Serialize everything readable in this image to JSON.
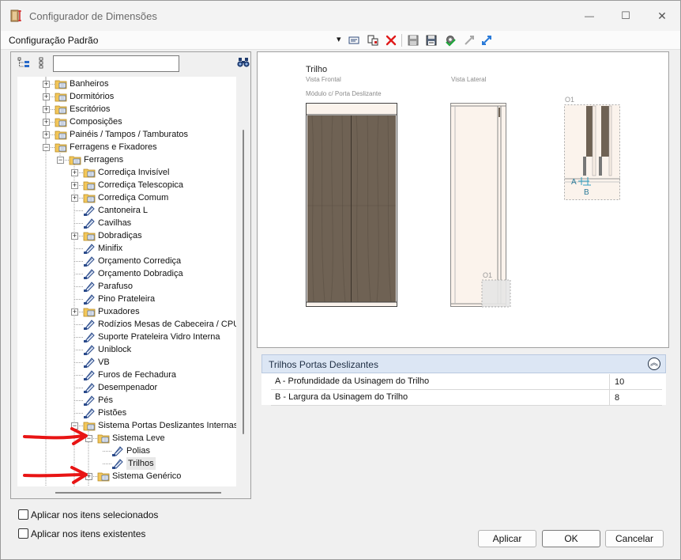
{
  "window": {
    "title": "Configurador de Dimensões",
    "minimize_glyph": "—",
    "maximize_glyph": "☐",
    "close_glyph": "✕"
  },
  "toolbar": {
    "config_name": "Configuração Padrão",
    "dropdown_glyph": "▾",
    "icons": [
      "settings-list-icon",
      "copy-config-icon",
      "delete-icon",
      "save-icon",
      "save-as-icon",
      "apply-gear-icon",
      "expand-diagonal-icon",
      "collapse-diagonal-icon"
    ]
  },
  "tree": {
    "search_value": "",
    "nodes": [
      {
        "label": "Banheiros",
        "expander": "+",
        "icon": "folder"
      },
      {
        "label": "Dormitórios",
        "expander": "+",
        "icon": "folder"
      },
      {
        "label": "Escritórios",
        "expander": "+",
        "icon": "folder"
      },
      {
        "label": "Composições",
        "expander": "+",
        "icon": "folder"
      },
      {
        "label": "Painéis / Tampos / Tamburatos",
        "expander": "+",
        "icon": "folder"
      },
      {
        "label": "Ferragens e Fixadores",
        "expander": "−",
        "icon": "folder"
      },
      {
        "label": "Ferragens",
        "expander": "−",
        "icon": "folder"
      },
      {
        "label": "Corrediça Invisível",
        "expander": "+",
        "icon": "folder"
      },
      {
        "label": "Corrediça Telescopica",
        "expander": "+",
        "icon": "folder"
      },
      {
        "label": "Corrediça Comum",
        "expander": "+",
        "icon": "folder"
      },
      {
        "label": "Cantoneira L",
        "expander": "",
        "icon": "item"
      },
      {
        "label": "Cavilhas",
        "expander": "",
        "icon": "item"
      },
      {
        "label": "Dobradiças",
        "expander": "+",
        "icon": "folder"
      },
      {
        "label": "Minifix",
        "expander": "",
        "icon": "item"
      },
      {
        "label": "Orçamento Corrediça",
        "expander": "",
        "icon": "item"
      },
      {
        "label": "Orçamento Dobradiça",
        "expander": "",
        "icon": "item"
      },
      {
        "label": "Parafuso",
        "expander": "",
        "icon": "item"
      },
      {
        "label": "Pino Prateleira",
        "expander": "",
        "icon": "item"
      },
      {
        "label": "Puxadores",
        "expander": "+",
        "icon": "folder"
      },
      {
        "label": "Rodízios Mesas de Cabeceira / CPU",
        "expander": "",
        "icon": "item"
      },
      {
        "label": "Suporte Prateleira Vidro Interna",
        "expander": "",
        "icon": "item"
      },
      {
        "label": "Uniblock",
        "expander": "",
        "icon": "item"
      },
      {
        "label": "VB",
        "expander": "",
        "icon": "item"
      },
      {
        "label": "Furos de Fechadura",
        "expander": "",
        "icon": "item"
      },
      {
        "label": "Desempenador",
        "expander": "",
        "icon": "item"
      },
      {
        "label": "Pés",
        "expander": "",
        "icon": "item"
      },
      {
        "label": "Pistões",
        "expander": "",
        "icon": "item"
      },
      {
        "label": "Sistema Portas Deslizantes Internas",
        "expander": "−",
        "icon": "folder"
      },
      {
        "label": "Sistema Leve",
        "expander": "−",
        "icon": "folder"
      },
      {
        "label": "Polias",
        "expander": "",
        "icon": "item"
      },
      {
        "label": "Trilhos",
        "expander": "",
        "icon": "item",
        "selected": true
      },
      {
        "label": "Sistema Genérico",
        "expander": "+",
        "icon": "folder"
      }
    ]
  },
  "preview": {
    "title": "Trilho",
    "front_view": "Vista Frontal",
    "side_view": "Vista Lateral",
    "module": "Módulo c/ Porta Deslizante",
    "detail_tag_side": "O1",
    "detail_tag_detail": "O1",
    "dim_a": "A",
    "dim_b": "B",
    "colors": {
      "wood": "#6f6254",
      "side_fill": "#fbf3ec"
    }
  },
  "properties": {
    "section_title": "Trilhos Portas Deslizantes",
    "collapse_glyph": "︽",
    "rows": [
      {
        "label": "A - Profundidade da Usinagem do Trilho",
        "value": "10"
      },
      {
        "label": "B - Largura da Usinagem do Trilho",
        "value": "8"
      }
    ]
  },
  "options": {
    "apply_selected": "Aplicar nos itens selecionados",
    "apply_existing": "Aplicar nos itens existentes"
  },
  "buttons": {
    "apply": "Aplicar",
    "ok": "OK",
    "cancel": "Cancelar"
  }
}
